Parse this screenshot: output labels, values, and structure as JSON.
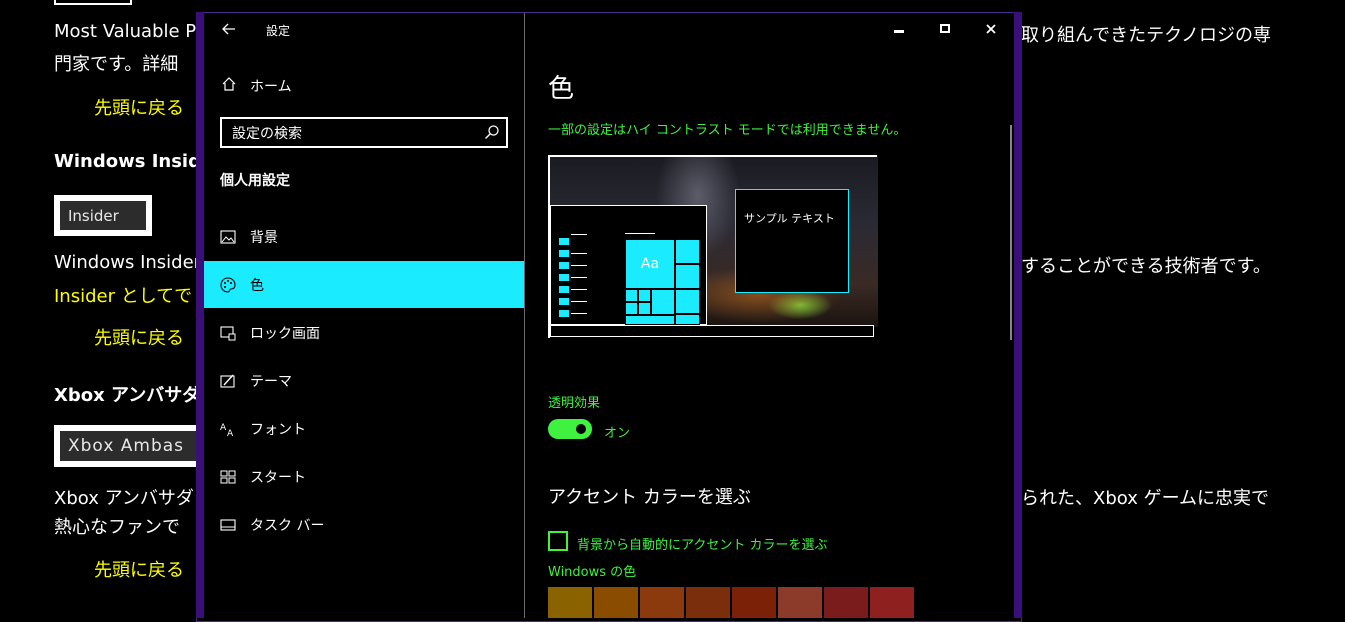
{
  "background_page": {
    "intro_line1": "Most Valuable Pr",
    "intro_line1_right": "取り組んできたテクノロジの専",
    "intro_line2": "門家です。詳細",
    "back_to_top_1": "先頭に戻る",
    "insider_heading": "Windows Inside",
    "insider_badge": "Insider",
    "insider_text_left": "Windows Insider",
    "insider_text_right": "することができる技術者です。",
    "insider_text_line2": "Insider としてで",
    "back_to_top_2": "先頭に戻る",
    "xbox_heading": "Xbox アンバサダ",
    "xbox_badge": "Xbox Ambas",
    "xbox_text_left": "Xbox アンバサダ",
    "xbox_text_right": "られた、Xbox ゲームに忠実で",
    "xbox_text_line2": "熱心なファンで",
    "back_to_top_3": "先頭に戻る"
  },
  "window": {
    "title": "設定",
    "back_icon": "back-arrow-icon",
    "caption": {
      "minimize": "minimize-icon",
      "maximize": "maximize-icon",
      "close": "close-icon"
    }
  },
  "nav": {
    "home_label": "ホーム",
    "search_placeholder": "設定の検索",
    "section_title": "個人用設定",
    "items": [
      {
        "label": "背景",
        "icon": "picture-icon"
      },
      {
        "label": "色",
        "icon": "palette-icon",
        "selected": true
      },
      {
        "label": "ロック画面",
        "icon": "lock-screen-icon"
      },
      {
        "label": "テーマ",
        "icon": "theme-icon"
      },
      {
        "label": "フォント",
        "icon": "font-icon"
      },
      {
        "label": "スタート",
        "icon": "start-icon"
      },
      {
        "label": "タスク バー",
        "icon": "taskbar-icon"
      }
    ]
  },
  "content": {
    "title": "色",
    "high_contrast_note": "一部の設定はハイ コントラスト モードでは利用できません。",
    "preview": {
      "sample_text": "サンプル テキスト",
      "tile_label": "Aa"
    },
    "transparency_label": "透明効果",
    "transparency_state": "オン",
    "transparency_on": true,
    "accent_heading": "アクセント カラーを選ぶ",
    "auto_accent_label": "背景から自動的にアクセント カラーを選ぶ",
    "auto_accent_checked": false,
    "windows_colors_label": "Windows の色",
    "swatches": [
      "#8a6300",
      "#8a4d00",
      "#8a3a0c",
      "#7a2e0c",
      "#7a2107",
      "#8c3a2a",
      "#7a1c1c",
      "#8e2020"
    ]
  },
  "colors": {
    "accent": "#1aebff",
    "hc_text": "#3ff23f",
    "link": "#ffff00",
    "window_frame": "#3b0f7a"
  }
}
